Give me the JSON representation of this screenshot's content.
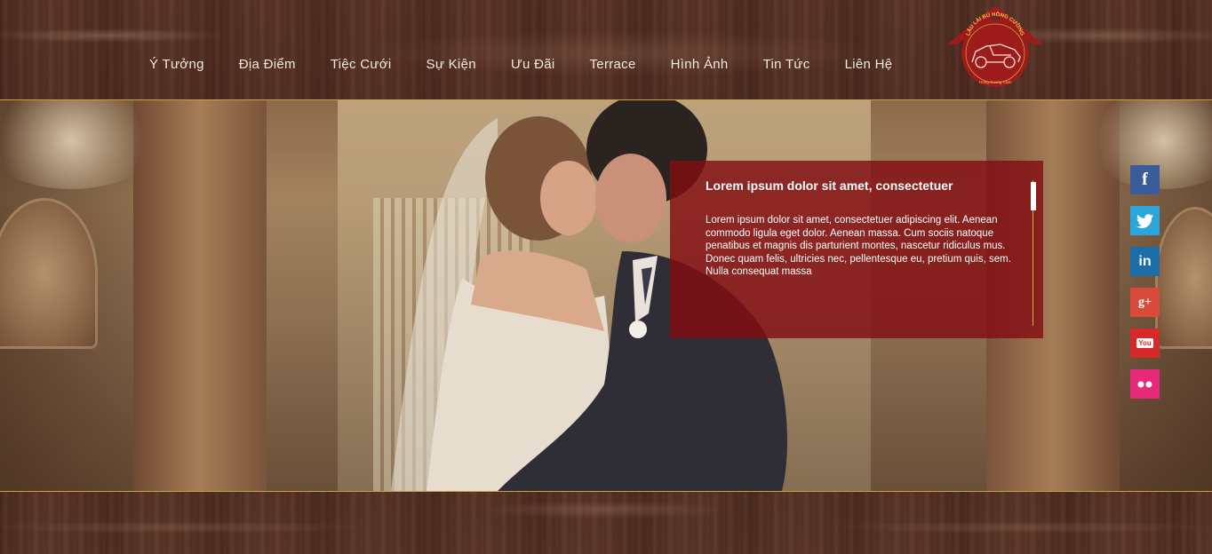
{
  "nav": {
    "items": [
      {
        "label": "Ý Tưởng"
      },
      {
        "label": "Địa Điểm"
      },
      {
        "label": "Tiệc Cưới"
      },
      {
        "label": "Sự Kiện"
      },
      {
        "label": "Ưu Đãi"
      },
      {
        "label": "Terrace"
      },
      {
        "label": "Hình Ảnh"
      },
      {
        "label": "Tin Tức"
      },
      {
        "label": "Liên Hệ"
      }
    ]
  },
  "logo": {
    "arc_text": "LÂU LÀI BÚ HỒNG CƯỜNG",
    "caption": "Hong Cuong Club",
    "color": "#9e1b1b"
  },
  "panel": {
    "title": "Lorem ipsum dolor sit amet, consectetuer",
    "body": "Lorem ipsum dolor sit amet, consectetuer adipiscing elit. Aenean commodo ligula eget dolor. Aenean massa. Cum sociis natoque penatibus et magnis dis parturient montes, nascetur ridiculus mus. Donec quam felis, ultricies nec, pellentesque eu, pretium quis, sem. Nulla consequat massa",
    "background": "#820e12"
  },
  "social": [
    {
      "icon": "facebook-icon",
      "glyph": "f",
      "color": "#3b5b9a"
    },
    {
      "icon": "twitter-icon",
      "glyph": "🐦",
      "color": "#2aa6dc"
    },
    {
      "icon": "linkedin-icon",
      "glyph": "in",
      "color": "#1c6ea8"
    },
    {
      "icon": "googleplus-icon",
      "glyph": "g+",
      "color": "#d84b3a"
    },
    {
      "icon": "youtube-icon",
      "glyph": "You",
      "color": "#d62a2a"
    },
    {
      "icon": "flickr-icon",
      "glyph": "●●",
      "color": "#e7297a"
    }
  ],
  "colors": {
    "accent_gold": "#c9a23f",
    "nav_text": "#f4e9dd"
  }
}
